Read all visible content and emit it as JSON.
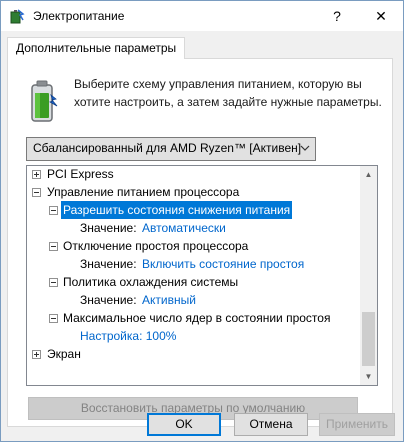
{
  "window": {
    "title": "Электропитание",
    "help_label": "?",
    "close_label": "✕"
  },
  "tab": {
    "label": "Дополнительные параметры"
  },
  "description": "Выберите схему управления питанием, которую вы хотите настроить, а затем задайте нужные параметры.",
  "plan_select": {
    "value": "Сбалансированный для AMD Ryzen™ [Активен]"
  },
  "tree": {
    "items": [
      {
        "label": "PCI Express",
        "expander": "plus"
      },
      {
        "label": "Управление питанием процессора",
        "expander": "minus"
      },
      {
        "label": "Разрешить состояния снижения питания",
        "expander": "minus",
        "selected": true
      },
      {
        "prefix": "Значение:",
        "value": "Автоматически"
      },
      {
        "label": "Отключение простоя процессора",
        "expander": "minus"
      },
      {
        "prefix": "Значение:",
        "value": "Включить состояние простоя"
      },
      {
        "label": "Политика охлаждения системы",
        "expander": "minus"
      },
      {
        "prefix": "Значение:",
        "value": "Активный"
      },
      {
        "label": "Максимальное число ядер в состоянии простоя",
        "expander": "minus"
      },
      {
        "setting": "Настройка: 100%"
      },
      {
        "label": "Экран",
        "expander": "plus"
      }
    ]
  },
  "buttons": {
    "restore": "Восстановить параметры по умолчанию",
    "ok": "OK",
    "cancel": "Отмена",
    "apply": "Применить"
  },
  "colors": {
    "selection": "#0078d7",
    "value_link": "#0066cc"
  }
}
